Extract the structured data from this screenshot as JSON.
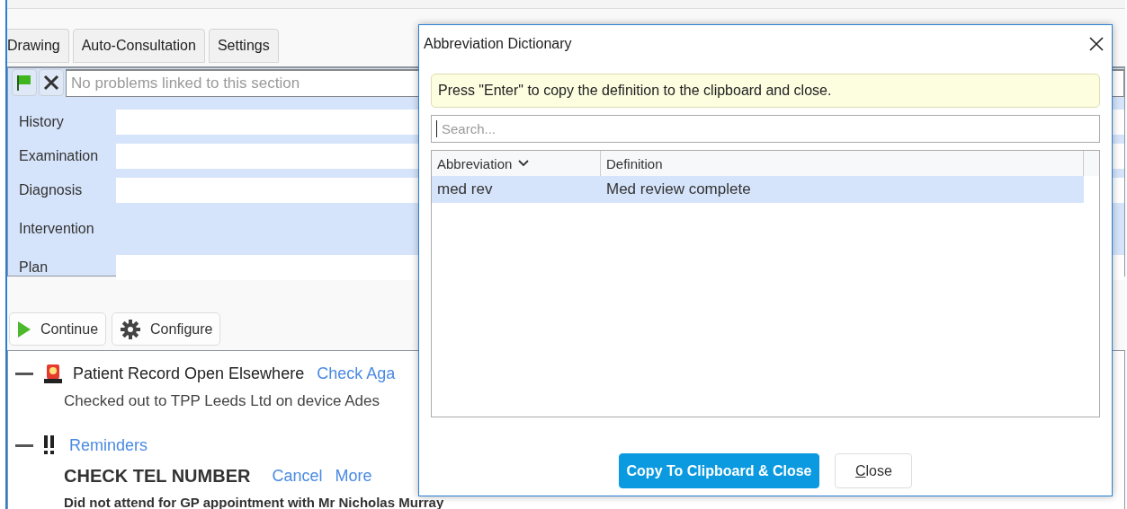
{
  "tabs": [
    {
      "label": "Drawing"
    },
    {
      "label": "Auto-Consultation"
    },
    {
      "label": "Settings"
    }
  ],
  "problems_bar": {
    "placeholder": "No problems linked to this section"
  },
  "sections": [
    {
      "label": "History",
      "kind": "field"
    },
    {
      "label": "Examination",
      "kind": "field"
    },
    {
      "label": "Diagnosis",
      "kind": "field"
    },
    {
      "label": "Intervention",
      "kind": "label"
    },
    {
      "label": "Plan",
      "kind": "field"
    }
  ],
  "toolbar": [
    {
      "label": "Continue",
      "kind": "play"
    },
    {
      "label": "Configure",
      "kind": "gear"
    }
  ],
  "alerts": [
    {
      "kind": "siren",
      "expanded": true,
      "title": "Patient Record Open Elsewhere",
      "link": "Check Aga",
      "detail": "Checked out to TPP Leeds Ltd on device Ades"
    },
    {
      "kind": "reminders",
      "expanded": true,
      "link": "Reminders",
      "items": [
        {
          "title": "CHECK TEL NUMBER",
          "actions": [
            "Cancel",
            "More"
          ],
          "detail": "Did not attend for GP appointment with Mr Nicholas Murray"
        }
      ]
    }
  ],
  "dialog": {
    "title": "Abbreviation Dictionary",
    "hint": "Press \"Enter\" to copy the definition to the clipboard and close.",
    "search": {
      "placeholder": "Search..."
    },
    "table": {
      "columns": [
        {
          "label": "Abbreviation",
          "sorted": true
        },
        {
          "label": "Definition",
          "sorted": false
        }
      ],
      "rows": [
        {
          "cells": [
            "med rev",
            "Med review complete"
          ],
          "selected": true
        }
      ]
    },
    "buttons": [
      {
        "label": "Copy To Clipboard & Close",
        "kind": "primary"
      },
      {
        "label": "Close",
        "kind": "secondary"
      }
    ]
  }
}
